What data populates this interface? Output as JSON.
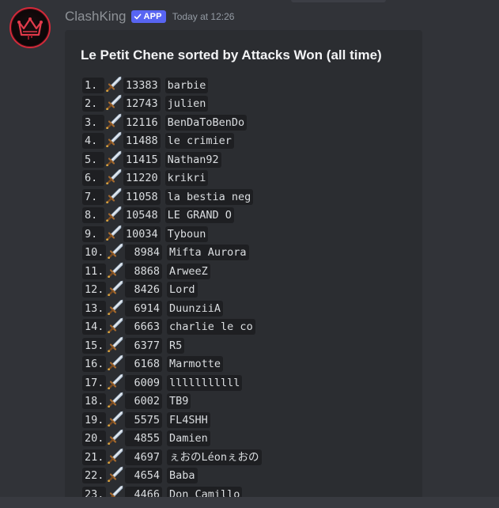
{
  "message": {
    "username": "ClashKing",
    "badge": "APP",
    "timestamp": "Today at 12:26",
    "avatar_icon": "crown-icon"
  },
  "embed": {
    "title": "Le Petit Chene sorted by Attacks Won (all time)",
    "rows": [
      {
        "rank": "1.",
        "score": "13383",
        "name": "barbie"
      },
      {
        "rank": "2.",
        "score": "12743",
        "name": "julien"
      },
      {
        "rank": "3.",
        "score": "12116",
        "name": "BenDaToBenDo"
      },
      {
        "rank": "4.",
        "score": "11488",
        "name": "le crimier"
      },
      {
        "rank": "5.",
        "score": "11415",
        "name": "Nathan92"
      },
      {
        "rank": "6.",
        "score": "11220",
        "name": "krikri"
      },
      {
        "rank": "7.",
        "score": "11058",
        "name": "la bestia neg"
      },
      {
        "rank": "8.",
        "score": "10548",
        "name": "LE GRAND O"
      },
      {
        "rank": "9.",
        "score": "10034",
        "name": "Tyboun"
      },
      {
        "rank": "10.",
        "score": " 8984",
        "name": "Mifta Aurora"
      },
      {
        "rank": "11.",
        "score": " 8868",
        "name": "ArweeZ"
      },
      {
        "rank": "12.",
        "score": " 8426",
        "name": "Lord"
      },
      {
        "rank": "13.",
        "score": " 6914",
        "name": "DuunziiA"
      },
      {
        "rank": "14.",
        "score": " 6663",
        "name": "charlie le co"
      },
      {
        "rank": "15.",
        "score": " 6377",
        "name": "R5"
      },
      {
        "rank": "16.",
        "score": " 6168",
        "name": "Marmotte"
      },
      {
        "rank": "17.",
        "score": " 6009",
        "name": "lllllllllll"
      },
      {
        "rank": "18.",
        "score": " 6002",
        "name": "TB9"
      },
      {
        "rank": "19.",
        "score": " 5575",
        "name": "FL4SHH"
      },
      {
        "rank": "20.",
        "score": " 4855",
        "name": "Damien"
      },
      {
        "rank": "21.",
        "score": " 4697",
        "name": "ぇおのLéonぇおの"
      },
      {
        "rank": "22.",
        "score": " 4654",
        "name": "Baba"
      },
      {
        "rank": "23.",
        "score": " 4466",
        "name": "Don Camillo"
      }
    ],
    "row_icon": "sword-icon"
  }
}
